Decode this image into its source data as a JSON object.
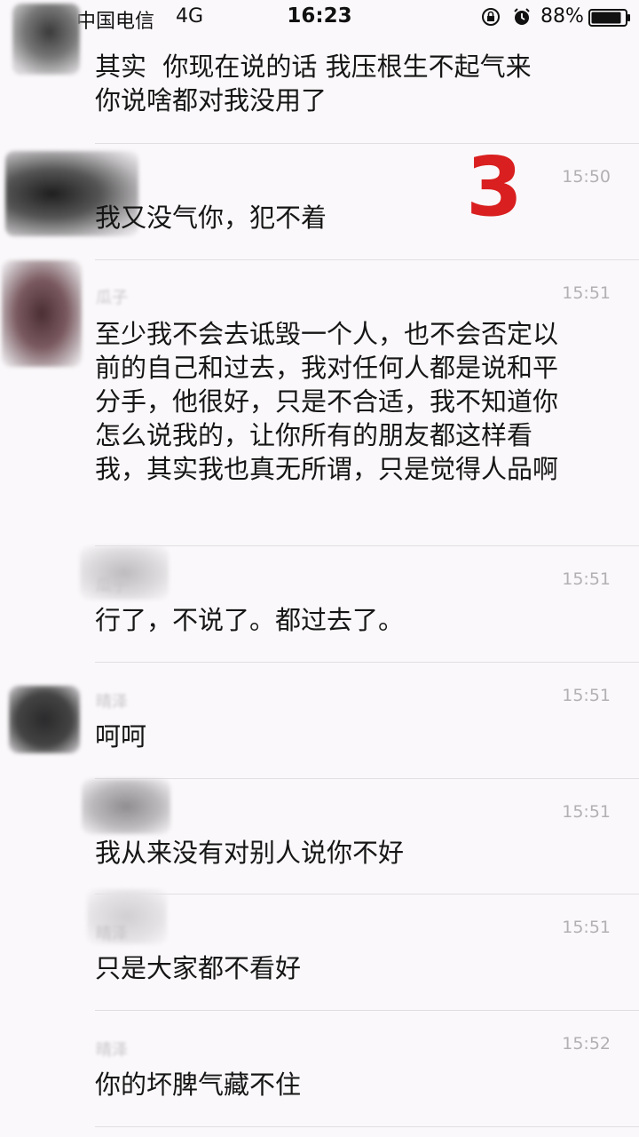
{
  "status_bar": {
    "carrier": "中国电信",
    "network": "4G",
    "time": "16:23",
    "battery": "88%",
    "battery_level": 0.88,
    "icons": [
      "lock-rotation-icon",
      "alarm-icon",
      "battery-icon"
    ]
  },
  "annotation": {
    "number": "3",
    "color": "#d91f1f"
  },
  "messages": [
    {
      "sender": "",
      "time": "",
      "text": "其实  你现在说的话 我压根生不起气来\n你说啥都对我没用了"
    },
    {
      "sender": "",
      "time": "15:50",
      "text": "我又没气你，犯不着"
    },
    {
      "sender": "瓜子",
      "time": "15:51",
      "text": "至少我不会去诋毁一个人，也不会否定以前的自己和过去，我对任何人都是说和平分手，他很好，只是不合适，我不知道你怎么说我的，让你所有的朋友都这样看我，其实我也真无所谓，只是觉得人品啊"
    },
    {
      "sender": "瓜子",
      "time": "15:51",
      "text": "行了，不说了。都过去了。"
    },
    {
      "sender": "晴泽",
      "time": "15:51",
      "text": "呵呵"
    },
    {
      "sender": "",
      "time": "15:51",
      "text": "我从来没有对别人说你不好"
    },
    {
      "sender": "晴泽",
      "time": "15:51",
      "text": "只是大家都不看好"
    },
    {
      "sender": "晴泽",
      "time": "15:52",
      "text": "你的坏脾气藏不住"
    }
  ]
}
